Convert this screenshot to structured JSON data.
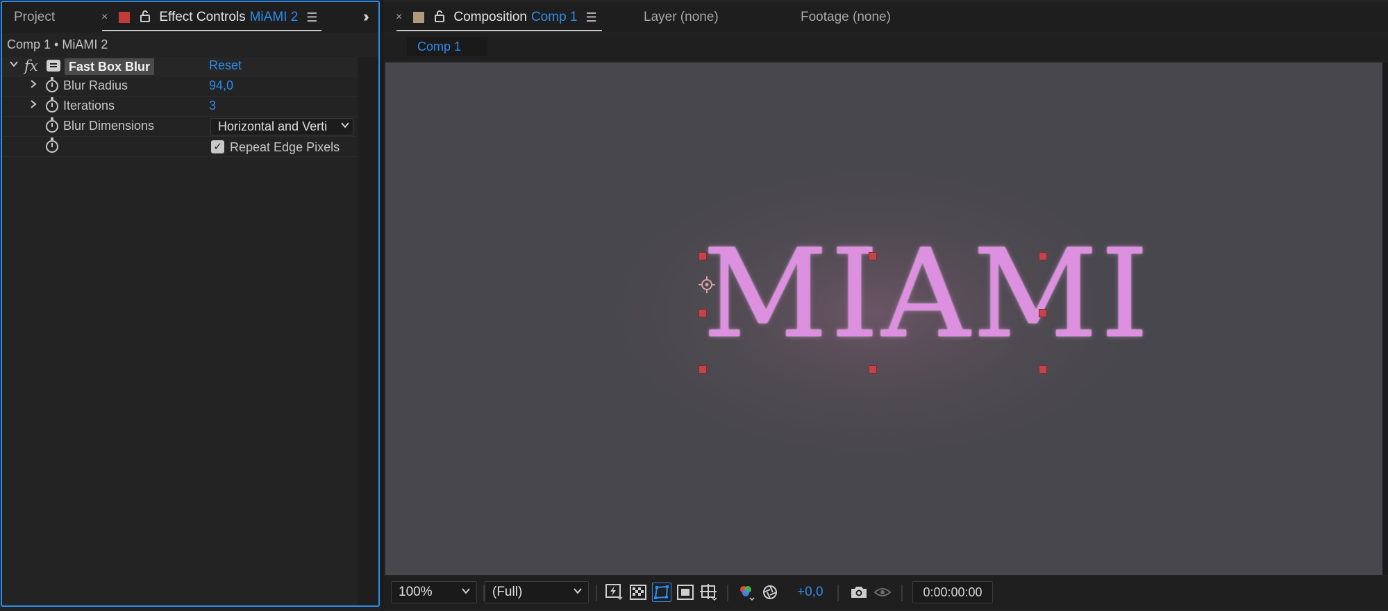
{
  "left_panel": {
    "tabs": {
      "project_label": "Project",
      "close_glyph": "×",
      "effect_controls_label": "Effect Controls",
      "effect_controls_layer": "MiAMI 2",
      "label_color": "#c23b3b"
    },
    "breadcrumb": "Comp 1 • MiAMI 2",
    "effect": {
      "fx_label": "fx",
      "name": "Fast Box Blur",
      "reset_label": "Reset",
      "properties": {
        "blur_radius": {
          "name": "Blur Radius",
          "value": "94,0"
        },
        "iterations": {
          "name": "Iterations",
          "value": "3"
        },
        "blur_dimensions": {
          "name": "Blur Dimensions",
          "value": "Horizontal and Verti"
        },
        "repeat_edge_pixels": {
          "label": "Repeat Edge Pixels",
          "checked": true
        }
      }
    }
  },
  "right_panel": {
    "tabs": {
      "close_glyph": "×",
      "composition_label": "Composition",
      "composition_name": "Comp 1",
      "layer_label": "Layer (none)",
      "footage_label": "Footage (none)",
      "label_color": "#b09a7a"
    },
    "subtab": "Comp 1",
    "canvas": {
      "text": "MIAMI",
      "text_color": "#dc90df",
      "handle_color": "#c4444a"
    },
    "bottom_bar": {
      "zoom": "100%",
      "resolution": "(Full)",
      "exposure": "+0,0",
      "timecode": "0:00:00:00"
    }
  },
  "accent_color": "#2d8ceb"
}
